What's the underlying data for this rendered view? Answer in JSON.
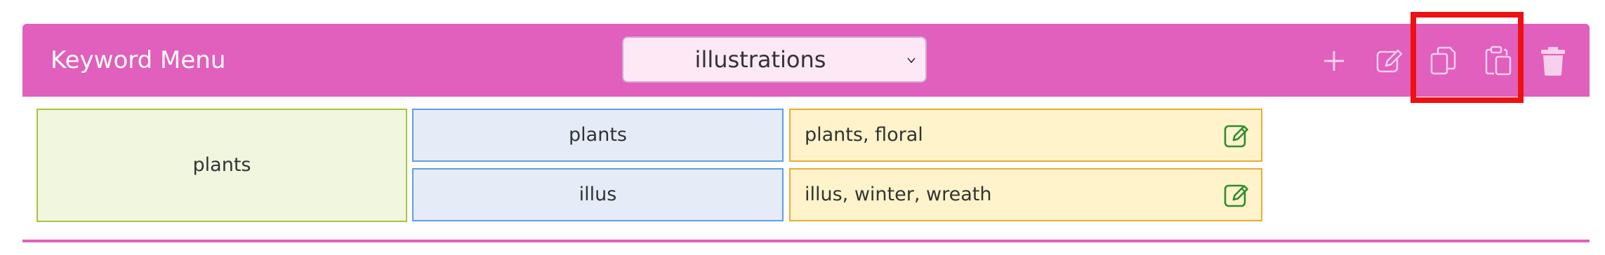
{
  "header": {
    "title": "Keyword Menu",
    "select": {
      "selected": "illustrations"
    },
    "toolbar": [
      {
        "name": "add-icon"
      },
      {
        "name": "edit-icon"
      },
      {
        "name": "copy-icon"
      },
      {
        "name": "paste-icon"
      },
      {
        "name": "trash-icon"
      }
    ]
  },
  "rows": {
    "category": "plants",
    "subcategories": [
      {
        "label": "plants",
        "keywords": "plants, floral"
      },
      {
        "label": "illus",
        "keywords": "illus, winter, wreath"
      }
    ]
  },
  "colors": {
    "header_bg": "#e15fbd",
    "select_bg": "#fde8f6",
    "category_bg": "#f1f6df",
    "subcategory_bg": "#e5ecf8",
    "keyword_bg": "#fef3ca",
    "highlight": "#ee1111",
    "edit_icon": "#2e8b2e"
  }
}
